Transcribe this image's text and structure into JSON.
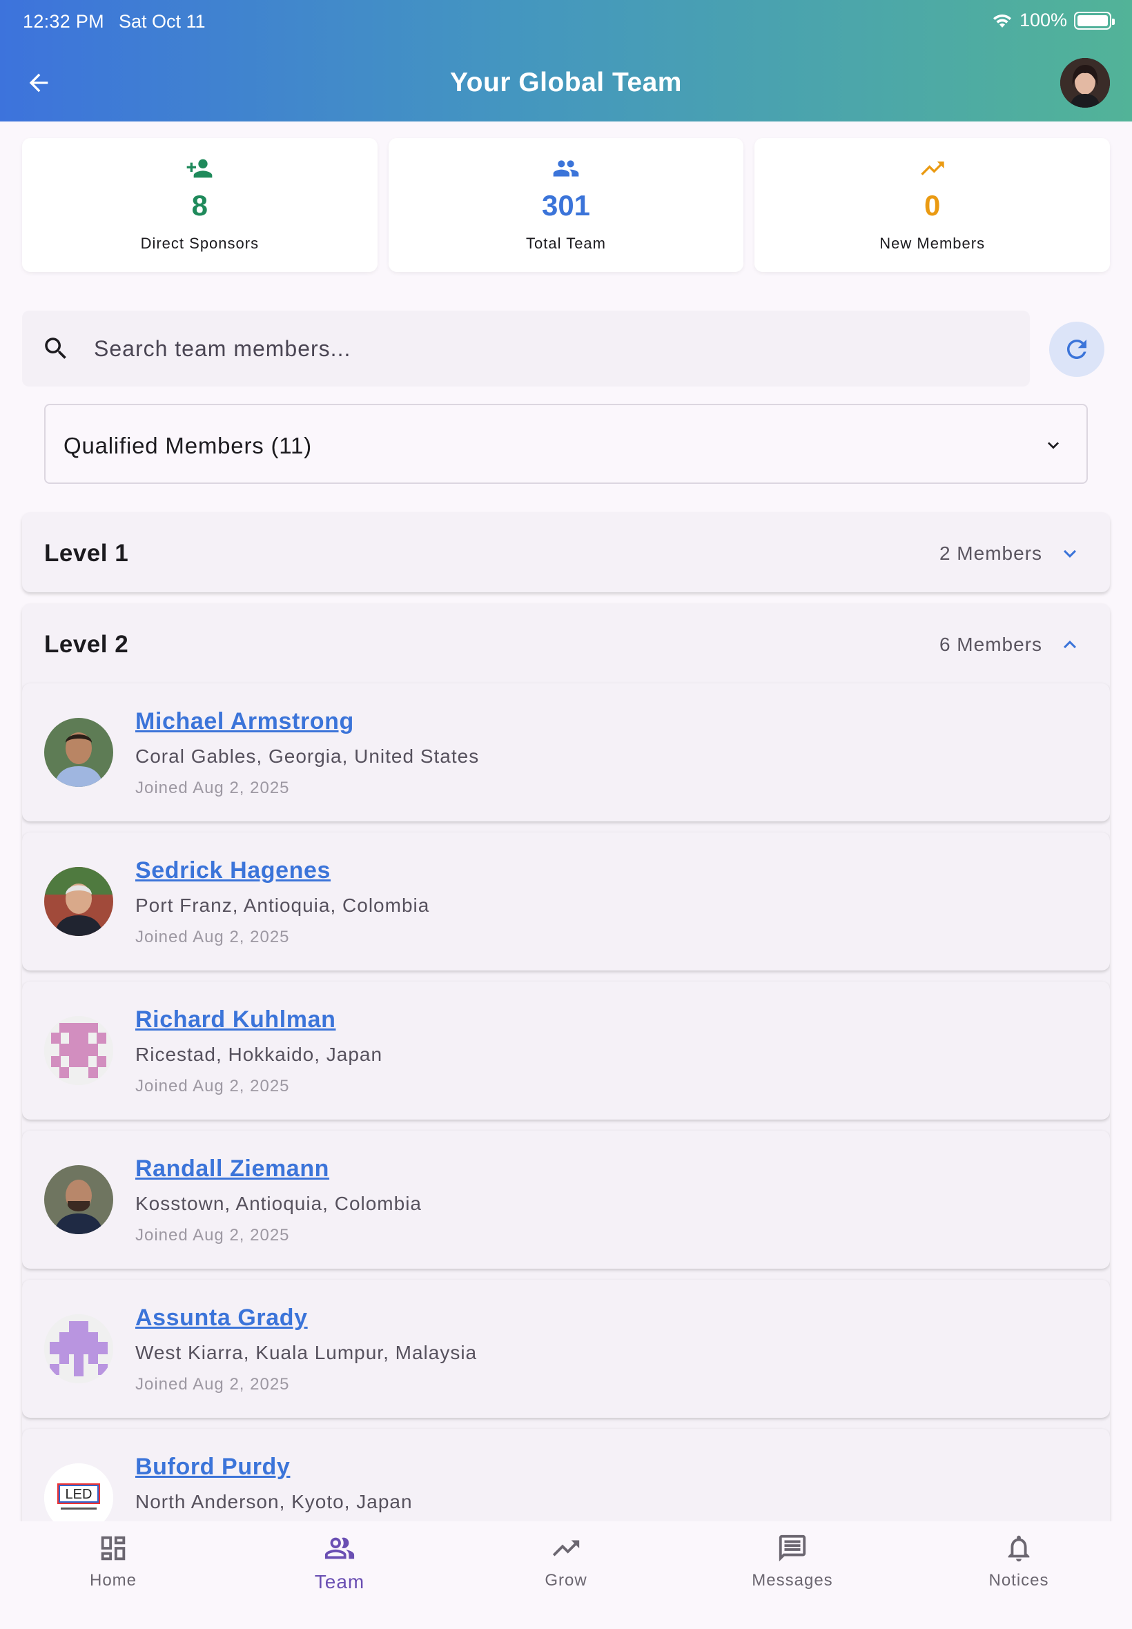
{
  "status_bar": {
    "time": "12:32 PM",
    "date": "Sat Oct 11",
    "battery": "100%"
  },
  "header": {
    "title": "Your Global Team"
  },
  "stats": [
    {
      "value": "8",
      "label": "Direct Sponsors",
      "icon": "person-add-icon",
      "color": "#1f8a5b"
    },
    {
      "value": "301",
      "label": "Total Team",
      "icon": "group-icon",
      "color": "#3b74d9"
    },
    {
      "value": "0",
      "label": "New Members",
      "icon": "trending-up-icon",
      "color": "#ea9a12"
    }
  ],
  "search": {
    "placeholder": "Search team members..."
  },
  "filter": {
    "selected": "Qualified Members (11)"
  },
  "levels": [
    {
      "title": "Level 1",
      "count": "2 Members",
      "expanded": false
    },
    {
      "title": "Level 2",
      "count": "6 Members",
      "expanded": true
    }
  ],
  "members": [
    {
      "name": "Michael Armstrong",
      "location": "Coral Gables, Georgia, United States",
      "joined": "Joined Aug 2, 2025"
    },
    {
      "name": "Sedrick Hagenes",
      "location": "Port Franz, Antioquia, Colombia",
      "joined": "Joined Aug 2, 2025"
    },
    {
      "name": "Richard Kuhlman",
      "location": "Ricestad, Hokkaido, Japan",
      "joined": "Joined Aug 2, 2025"
    },
    {
      "name": "Randall Ziemann",
      "location": "Kosstown, Antioquia, Colombia",
      "joined": "Joined Aug 2, 2025"
    },
    {
      "name": "Assunta Grady",
      "location": "West Kiarra, Kuala Lumpur, Malaysia",
      "joined": "Joined Aug 2, 2025"
    },
    {
      "name": "Buford Purdy",
      "location": "North Anderson, Kyoto, Japan",
      "joined": ""
    }
  ],
  "avatar_logo_text": "LED",
  "nav": [
    {
      "label": "Home",
      "icon": "dashboard-icon"
    },
    {
      "label": "Team",
      "icon": "group-outline-icon",
      "active": true
    },
    {
      "label": "Grow",
      "icon": "trending-up-icon"
    },
    {
      "label": "Messages",
      "icon": "message-icon"
    },
    {
      "label": "Notices",
      "icon": "bell-icon"
    }
  ]
}
